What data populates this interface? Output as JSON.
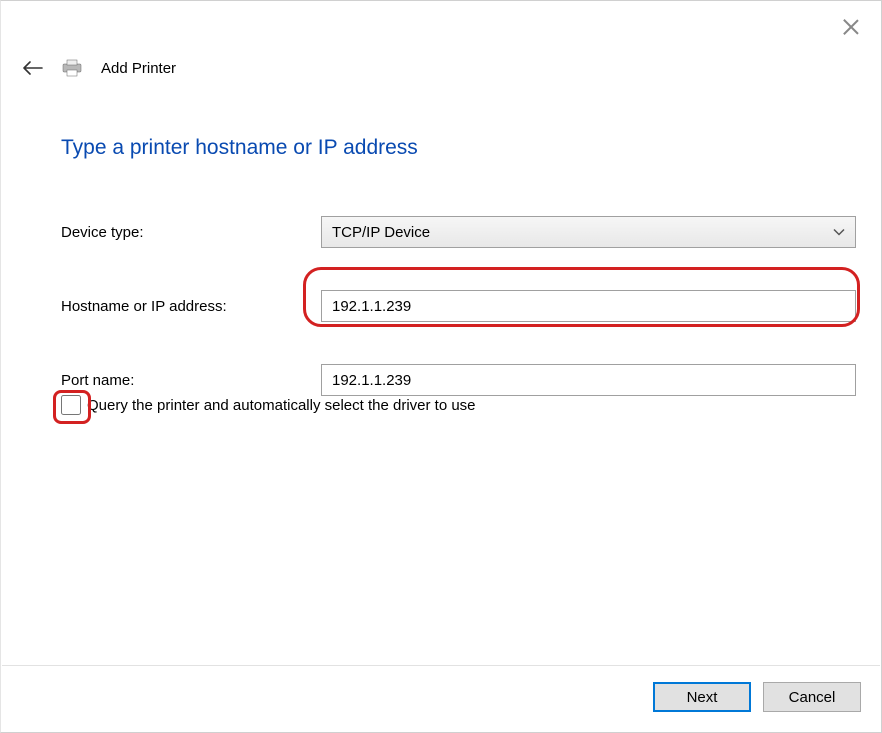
{
  "header": {
    "title": "Add Printer"
  },
  "page": {
    "heading": "Type a printer hostname or IP address"
  },
  "form": {
    "device_type_label": "Device type:",
    "device_type_value": "TCP/IP Device",
    "hostname_label": "Hostname or IP address:",
    "hostname_value": "192.1.1.239",
    "port_name_label": "Port name:",
    "port_name_value": "192.1.1.239",
    "query_checkbox_label": "Query the printer and automatically select the driver to use"
  },
  "buttons": {
    "next": "Next",
    "cancel": "Cancel"
  }
}
